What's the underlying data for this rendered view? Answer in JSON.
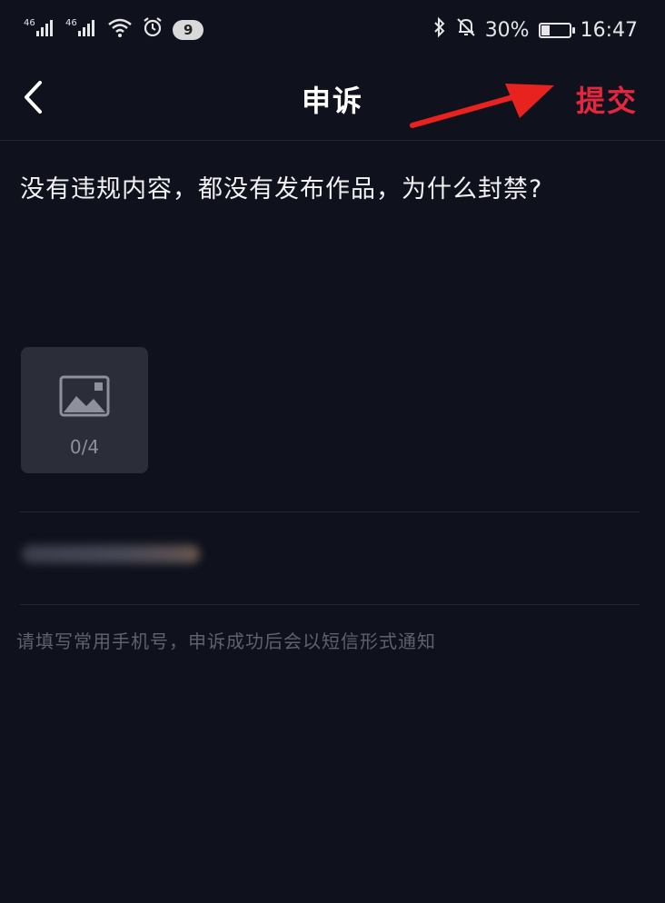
{
  "status_bar": {
    "signal_1": "⁴⁶",
    "signal_2": "⁴⁶",
    "notification_count": "9",
    "battery": "30%",
    "battery_level": 0.3,
    "time": "16:47",
    "icons": [
      "signal-icon",
      "signal-icon",
      "wifi-icon",
      "alarm-icon",
      "bluetooth-icon",
      "mute-icon",
      "battery-icon"
    ]
  },
  "nav": {
    "title": "申诉",
    "submit_label": "提交",
    "submit_color": "#e5263f"
  },
  "form": {
    "appeal_text": "没有违规内容，都没有发布作品，为什么封禁?",
    "image_count": "0/4",
    "hint": "请填写常用手机号，申诉成功后会以短信形式通知"
  },
  "colors": {
    "background": "#0f111c",
    "accent": "#e5263f",
    "annotation_arrow": "#e8221f"
  }
}
